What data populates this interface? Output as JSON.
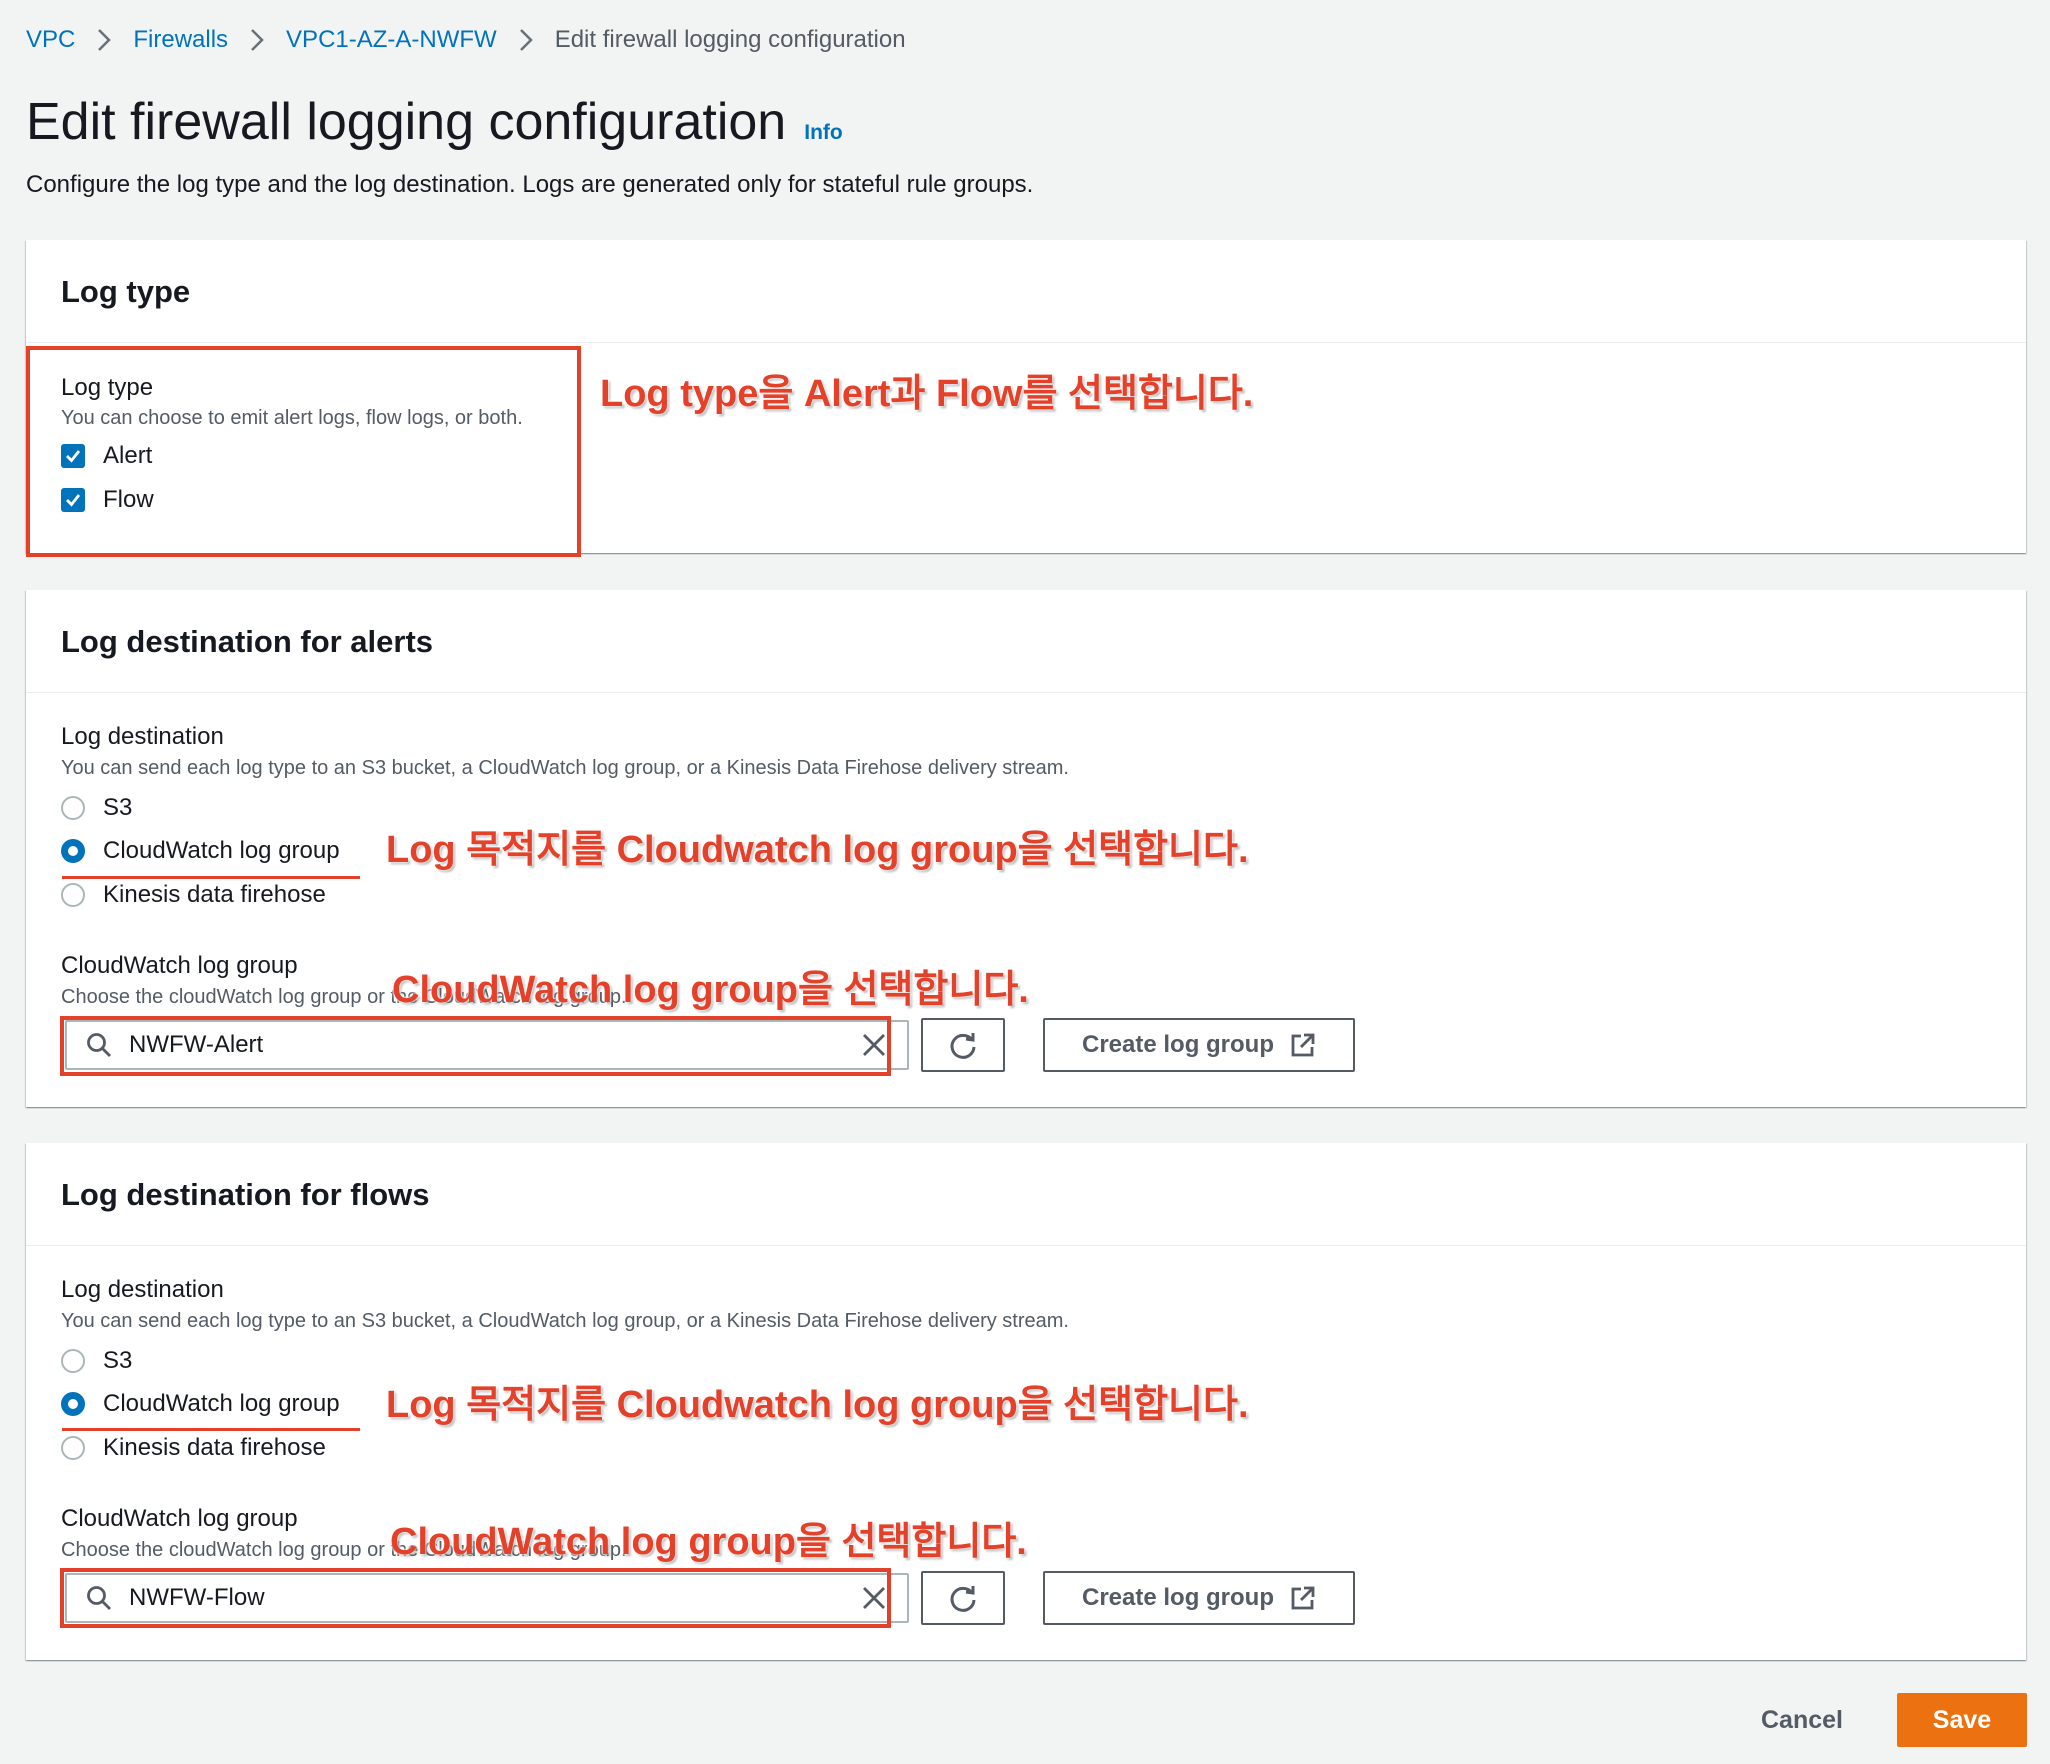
{
  "breadcrumb": {
    "items": [
      "VPC",
      "Firewalls",
      "VPC1-AZ-A-NWFW"
    ],
    "current": "Edit firewall logging configuration"
  },
  "header": {
    "title": "Edit firewall logging configuration",
    "info": "Info",
    "description": "Configure the log type and the log destination. Logs are generated only for stateful rule groups."
  },
  "log_type_panel": {
    "title": "Log type",
    "label": "Log type",
    "description": "You can choose to emit alert logs, flow logs, or both.",
    "options": [
      {
        "label": "Alert",
        "checked": true
      },
      {
        "label": "Flow",
        "checked": true
      }
    ],
    "annotation": "Log type을 Alert과 Flow를 선택합니다."
  },
  "alerts_panel": {
    "title": "Log destination for alerts",
    "dest_label": "Log destination",
    "dest_description": "You can send each log type to an S3 bucket, a CloudWatch log group, or a Kinesis Data Firehose delivery stream.",
    "options": [
      {
        "label": "S3",
        "selected": false
      },
      {
        "label": "CloudWatch log group",
        "selected": true
      },
      {
        "label": "Kinesis data firehose",
        "selected": false
      }
    ],
    "dest_annotation": "Log 목적지를 Cloudwatch log group을 선택합니다.",
    "group_label": "CloudWatch log group",
    "group_description": "Choose the cloudWatch log group or the CloudWatch log group.",
    "group_annotation": "CloudWatch log group을 선택합니다.",
    "search_value": "NWFW-Alert",
    "create_label": "Create log group"
  },
  "flows_panel": {
    "title": "Log destination for flows",
    "dest_label": "Log destination",
    "dest_description": "You can send each log type to an S3 bucket, a CloudWatch log group, or a Kinesis Data Firehose delivery stream.",
    "options": [
      {
        "label": "S3",
        "selected": false
      },
      {
        "label": "CloudWatch log group",
        "selected": true
      },
      {
        "label": "Kinesis data firehose",
        "selected": false
      }
    ],
    "dest_annotation": "Log 목적지를 Cloudwatch log group을 선택합니다.",
    "group_label": "CloudWatch log group",
    "group_description": "Choose the cloudWatch log group or the CloudWatch log group.",
    "group_annotation": "CloudWatch log group을 선택합니다.",
    "search_value": "NWFW-Flow",
    "create_label": "Create log group"
  },
  "footer": {
    "cancel_label": "Cancel",
    "save_label": "Save"
  },
  "colors": {
    "link": "#0073bb",
    "primary_button": "#ec7211",
    "annotation": "#e4412a",
    "background": "#f2f3f3"
  },
  "icons": [
    "chevron-right-icon",
    "check-icon",
    "search-icon",
    "clear-icon",
    "refresh-icon",
    "external-link-icon"
  ]
}
